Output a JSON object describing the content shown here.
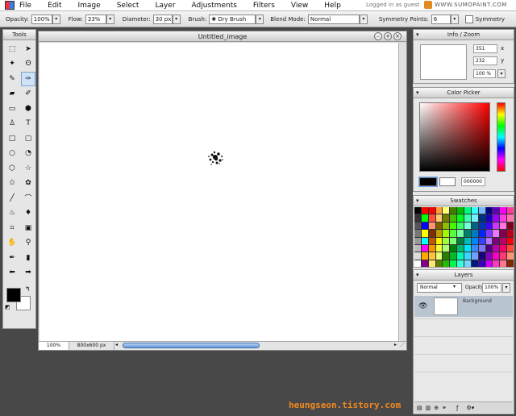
{
  "menu": {
    "items": [
      "File",
      "Edit",
      "Image",
      "Select",
      "Layer",
      "Adjustments",
      "Filters",
      "View",
      "Help"
    ],
    "login_text": "Logged in as guest",
    "brand": "WWW.SUMOPAINT.COM"
  },
  "options": {
    "opacity_label": "Opacity:",
    "opacity_value": "100%",
    "flow_label": "Flow:",
    "flow_value": "33%",
    "diameter_label": "Diameter:",
    "diameter_value": "30 px",
    "brush_label": "Brush:",
    "brush_value": "Dry Brush",
    "blend_label": "Blend Mode:",
    "blend_value": "Normal",
    "sym_label": "Symmetry Points:",
    "sym_value": "6",
    "symmetry_label": "Symmetry"
  },
  "tools": {
    "title": "Tools",
    "icons": [
      "marquee-icon",
      "move-icon",
      "magic-wand-icon",
      "lasso-icon",
      "pencil-icon",
      "brush-icon",
      "eraser-icon",
      "smudge-icon",
      "gradient-icon",
      "bucket-icon",
      "stamp-icon",
      "text-icon",
      "rectangle-icon",
      "rounded-rect-icon",
      "ellipse-icon",
      "pie-icon",
      "hexagon-icon",
      "star-icon",
      "star-outline-icon",
      "flower-icon",
      "line-icon",
      "curve-icon",
      "burn-icon",
      "dodge-icon",
      "crop-icon",
      "transform-icon",
      "hand-icon",
      "zoom-icon",
      "eyedropper-icon",
      "tube-icon",
      "arrow-left-icon",
      "arrow-right-icon"
    ],
    "glyphs": [
      "⬚",
      "➤",
      "✦",
      "ʘ",
      "✎",
      "✑",
      "▰",
      "✐",
      "▭",
      "⬢",
      "♙",
      "T",
      "□",
      "▢",
      "○",
      "◔",
      "⬡",
      "☆",
      "✩",
      "✿",
      "╱",
      "⌒",
      "♨",
      "♦",
      "⌗",
      "▣",
      "✋",
      "⚲",
      "✒",
      "▮",
      "⬅",
      "➡"
    ],
    "selected_index": 5
  },
  "document": {
    "title": "Untitled_image",
    "zoom": "100%",
    "size": "800x600 px",
    "horizontal_scroll_fraction": 0.5
  },
  "info_zoom": {
    "title": "Info / Zoom",
    "x_value": "351",
    "x_label": "x",
    "y_value": "232",
    "y_label": "y",
    "zoom_value": "100 %"
  },
  "color_picker": {
    "title": "Color Picker",
    "hex_value": "000000",
    "primary": "#000000",
    "secondary": "#ffffff"
  },
  "swatches": {
    "title": "Swatches"
  },
  "layers": {
    "title": "Layers",
    "blend": "Normal",
    "opacity_label": "Opacity:",
    "opacity_value": "100%",
    "layer_name": "Background"
  },
  "watermark": "heungseon.tistory.com"
}
